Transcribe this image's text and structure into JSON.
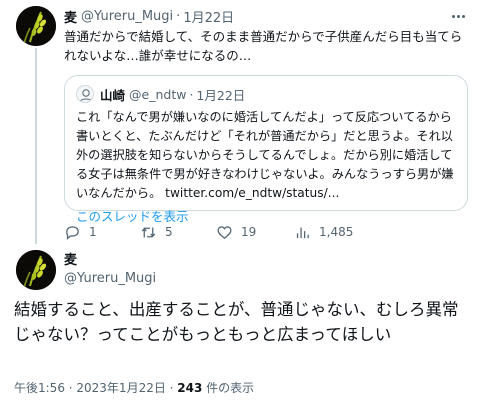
{
  "tweet1": {
    "name": "麦",
    "handle": "@Yureru_Mugi",
    "separator": "·",
    "date": "1月22日",
    "text": "普通だからで結婚して、そのまま普通だからで子供産んだら目も当てられないよな…誰が幸せになるの…",
    "quote": {
      "name": "山崎",
      "handle": "@e_ndtw",
      "separator": "·",
      "date": "1月22日",
      "text": "これ「なんで男が嫌いなのに婚活してんだよ」って反応ついてるから書いとくと、たぶんだけど「それが普通だから」だと思うよ。それ以外の選択肢を知らないからそうしてるんでしょ。だから別に婚活してる女子は無条件で男が好きなわけじゃないよ。みんなうっすら男が嫌いなんだから。 twitter.com/e_ndtw/status/...",
      "show_thread": "このスレッドを表示"
    },
    "actions": {
      "replies": "1",
      "retweets": "5",
      "likes": "19",
      "views": "1,485"
    }
  },
  "tweet2": {
    "name": "麦",
    "handle": "@Yureru_Mugi",
    "text": "結婚すること、出産することが、普通じゃない、むしろ異常じゃない？ってことがもっともっと広まってほしい",
    "time": "午後1:56 · 2023年1月22日 · ",
    "view_count": "243",
    "view_label": " 件の表示"
  },
  "icons": {
    "reply": "reply-icon",
    "retweet": "retweet-icon",
    "like": "heart-icon",
    "views": "views-chart-icon",
    "more": "more-dots-icon"
  },
  "colors": {
    "text": "#0f1419",
    "secondary": "#536471",
    "link": "#1d9bf0",
    "border": "#cfd9de"
  }
}
